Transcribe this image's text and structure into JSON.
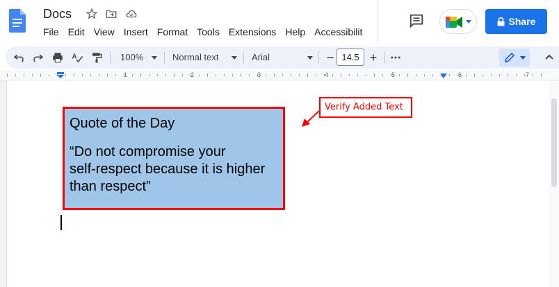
{
  "header": {
    "title": "Docs",
    "menu": [
      "File",
      "Edit",
      "View",
      "Insert",
      "Format",
      "Tools",
      "Extensions",
      "Help",
      "Accessibilit"
    ],
    "share_label": "Share"
  },
  "toolbar": {
    "zoom": "100%",
    "style": "Normal text",
    "font": "Arial",
    "font_size": "14.5"
  },
  "ruler": {
    "numbers": [
      "1",
      "2",
      "3",
      "4",
      "5",
      "6",
      "7"
    ]
  },
  "document": {
    "quote_title": "Quote of the Day",
    "quote_lines": [
      "“Do not compromise your",
      "self-respect because it is higher",
      "than respect”"
    ]
  },
  "annotation": {
    "label": "Verify Added Text",
    "color": "#ff0000"
  },
  "colors": {
    "accent": "#1a73e8",
    "box_fill": "#9fc5e8",
    "box_border": "#ff0000"
  }
}
